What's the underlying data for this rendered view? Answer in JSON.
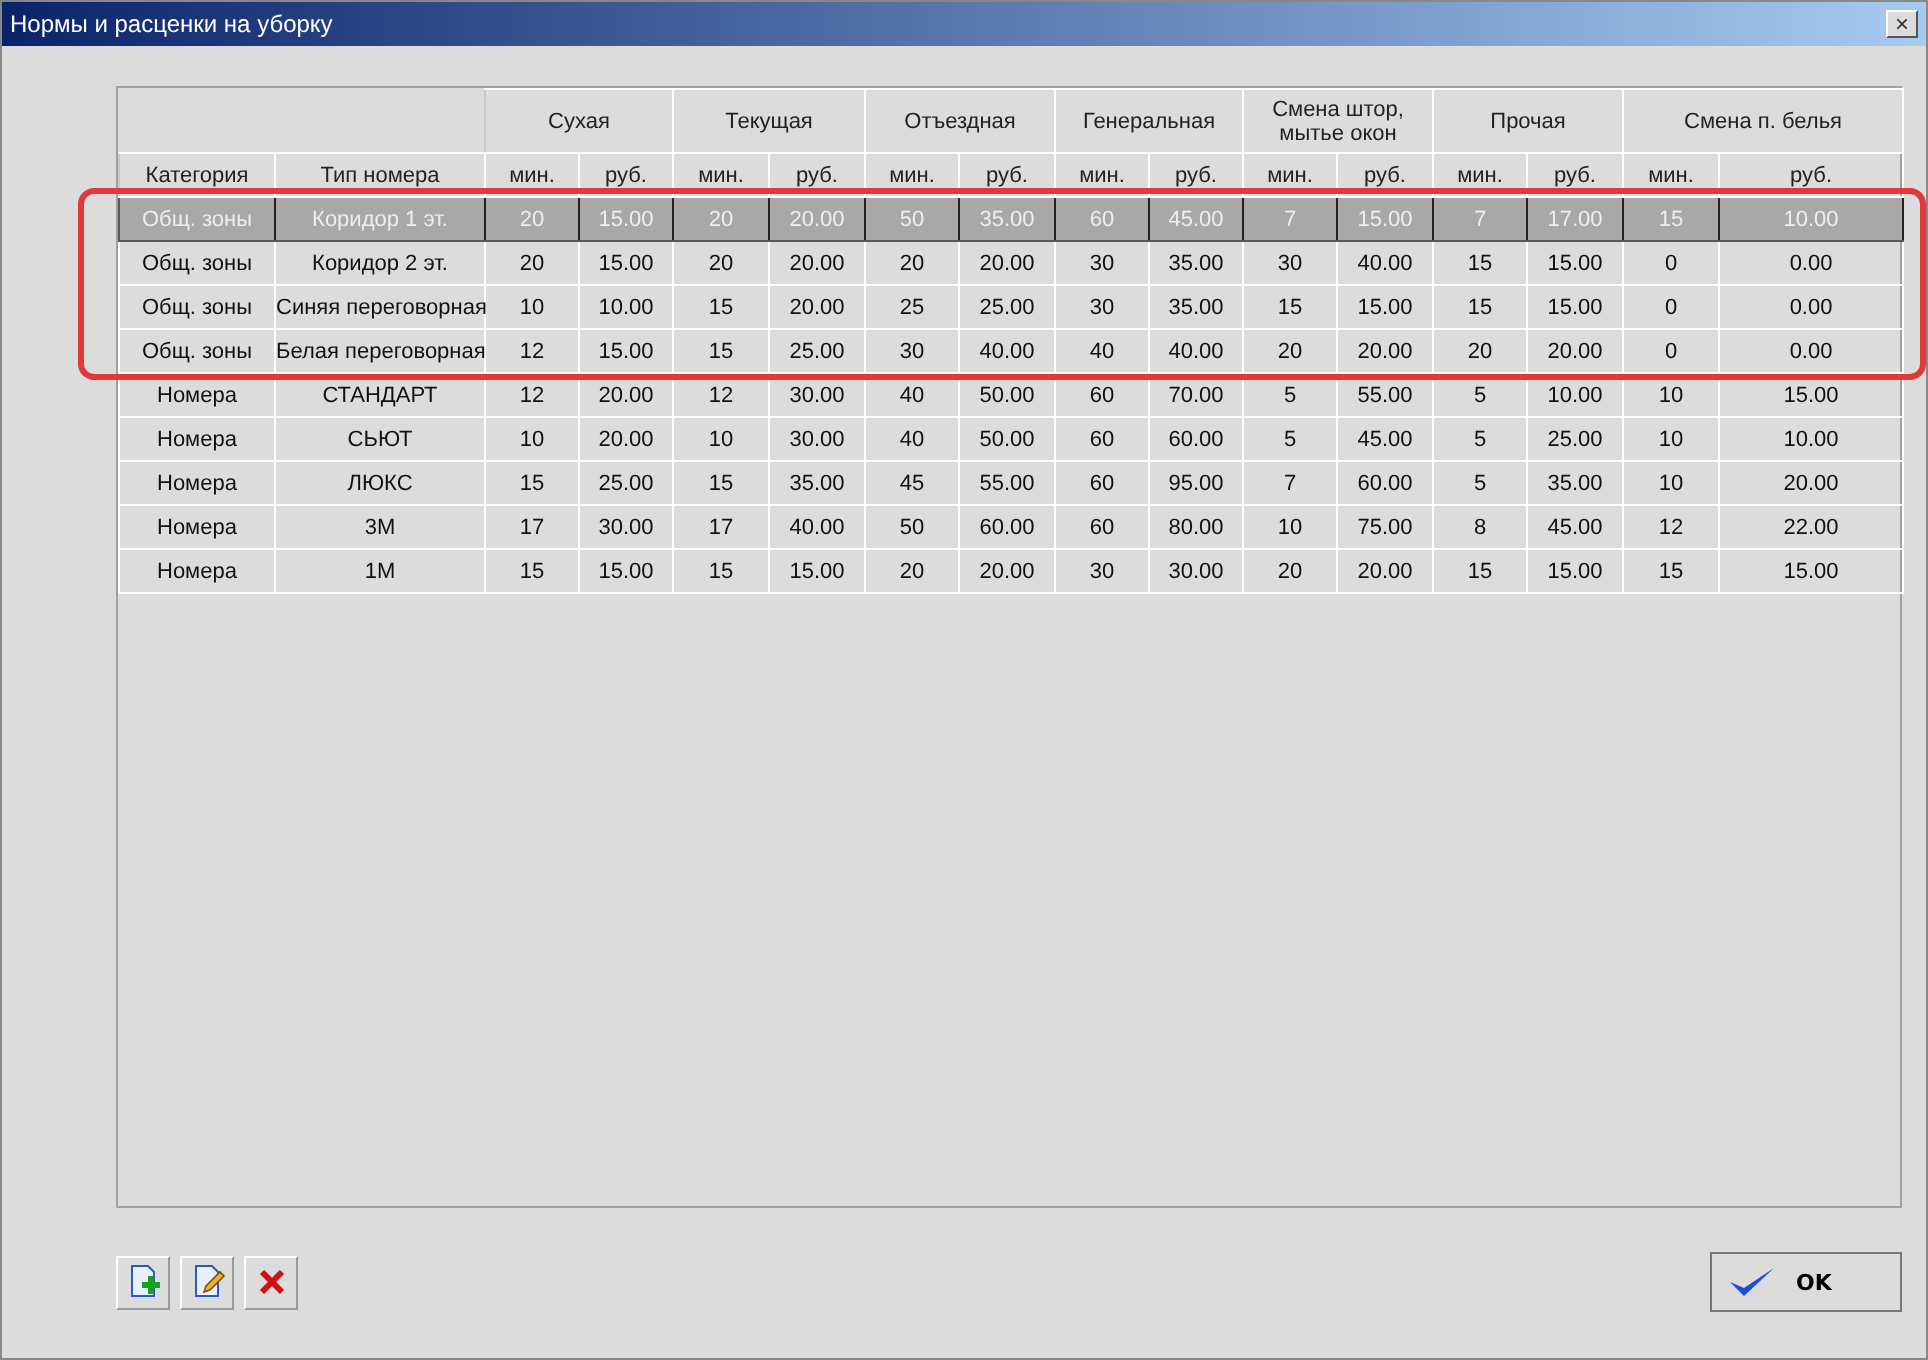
{
  "window": {
    "title": "Нормы и расценки на уборку",
    "close": "×"
  },
  "table": {
    "groups": [
      "Сухая",
      "Текущая",
      "Отъездная",
      "Генеральная",
      "Смена штор, мытье окон",
      "Прочая",
      "Смена п. белья"
    ],
    "columns": [
      "Категория",
      "Тип номера",
      "мин.",
      "руб.",
      "мин.",
      "руб.",
      "мин.",
      "руб.",
      "мин.",
      "руб.",
      "мин.",
      "руб.",
      "мин.",
      "руб.",
      "мин.",
      "руб."
    ],
    "rows": [
      {
        "selected": true,
        "highlighted": true,
        "cells": [
          "Общ. зоны",
          "Коридор 1 эт.",
          "20",
          "15.00",
          "20",
          "20.00",
          "50",
          "35.00",
          "60",
          "45.00",
          "7",
          "15.00",
          "7",
          "17.00",
          "15",
          "10.00"
        ]
      },
      {
        "selected": false,
        "highlighted": true,
        "cells": [
          "Общ. зоны",
          "Коридор 2 эт.",
          "20",
          "15.00",
          "20",
          "20.00",
          "20",
          "20.00",
          "30",
          "35.00",
          "30",
          "40.00",
          "15",
          "15.00",
          "0",
          "0.00"
        ]
      },
      {
        "selected": false,
        "highlighted": true,
        "cells": [
          "Общ. зоны",
          "Синяя переговорная",
          "10",
          "10.00",
          "15",
          "20.00",
          "25",
          "25.00",
          "30",
          "35.00",
          "15",
          "15.00",
          "15",
          "15.00",
          "0",
          "0.00"
        ]
      },
      {
        "selected": false,
        "highlighted": true,
        "cells": [
          "Общ. зоны",
          "Белая переговорная",
          "12",
          "15.00",
          "15",
          "25.00",
          "30",
          "40.00",
          "40",
          "40.00",
          "20",
          "20.00",
          "20",
          "20.00",
          "0",
          "0.00"
        ]
      },
      {
        "selected": false,
        "highlighted": false,
        "cells": [
          "Номера",
          "СТАНДАРТ",
          "12",
          "20.00",
          "12",
          "30.00",
          "40",
          "50.00",
          "60",
          "70.00",
          "5",
          "55.00",
          "5",
          "10.00",
          "10",
          "15.00"
        ]
      },
      {
        "selected": false,
        "highlighted": false,
        "cells": [
          "Номера",
          "СЬЮТ",
          "10",
          "20.00",
          "10",
          "30.00",
          "40",
          "50.00",
          "60",
          "60.00",
          "5",
          "45.00",
          "5",
          "25.00",
          "10",
          "10.00"
        ]
      },
      {
        "selected": false,
        "highlighted": false,
        "cells": [
          "Номера",
          "ЛЮКС",
          "15",
          "25.00",
          "15",
          "35.00",
          "45",
          "55.00",
          "60",
          "95.00",
          "7",
          "60.00",
          "5",
          "35.00",
          "10",
          "20.00"
        ]
      },
      {
        "selected": false,
        "highlighted": false,
        "cells": [
          "Номера",
          "3М",
          "17",
          "30.00",
          "17",
          "40.00",
          "50",
          "60.00",
          "60",
          "80.00",
          "10",
          "75.00",
          "8",
          "45.00",
          "12",
          "22.00"
        ]
      },
      {
        "selected": false,
        "highlighted": false,
        "cells": [
          "Номера",
          "1М",
          "15",
          "15.00",
          "15",
          "15.00",
          "20",
          "20.00",
          "30",
          "30.00",
          "20",
          "20.00",
          "15",
          "15.00",
          "15",
          "15.00"
        ]
      }
    ]
  },
  "ok_button": "OK"
}
